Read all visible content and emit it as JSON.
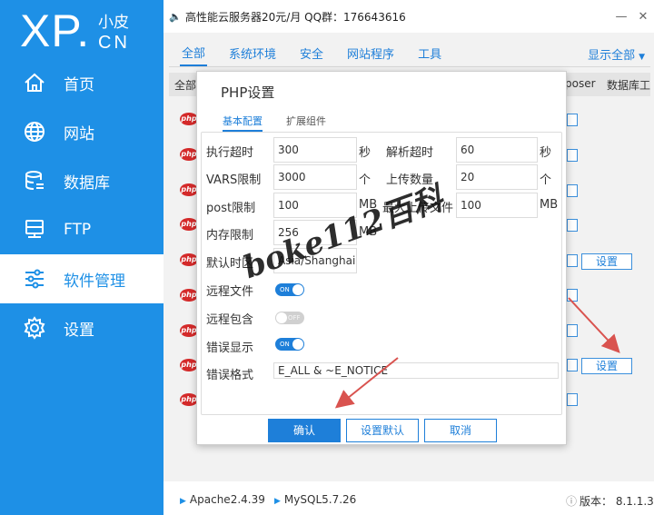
{
  "logo": {
    "big": "XP.",
    "small_top": "小皮",
    "small_bottom": "CN"
  },
  "sidebar": {
    "items": [
      {
        "label": "首页",
        "icon": "home-icon"
      },
      {
        "label": "网站",
        "icon": "globe-icon"
      },
      {
        "label": "数据库",
        "icon": "database-icon"
      },
      {
        "label": "FTP",
        "icon": "ftp-icon"
      },
      {
        "label": "软件管理",
        "icon": "sliders-icon",
        "active": true
      },
      {
        "label": "设置",
        "icon": "gear-icon"
      }
    ]
  },
  "topbar": {
    "notice": "高性能云服务器20元/月  QQ群：176643616",
    "min": "—",
    "close": "✕"
  },
  "tabs": {
    "items": [
      "全部",
      "系统环境",
      "安全",
      "网站程序",
      "工具"
    ],
    "right": "显示全部"
  },
  "table": {
    "header_left": "全部",
    "header_composer": "poser",
    "header_db": "数据库工"
  },
  "rows": {
    "php_label": "php",
    "set_label": "设置"
  },
  "dialog": {
    "title": "PHP设置",
    "tabs": [
      "基本配置",
      "扩展组件"
    ],
    "fields": {
      "exec_timeout": {
        "label": "执行超时",
        "value": "300",
        "unit": "秒"
      },
      "parse_timeout": {
        "label": "解析超时",
        "value": "60",
        "unit": "秒"
      },
      "vars_limit": {
        "label": "VARS限制",
        "value": "3000",
        "unit": "个"
      },
      "upload_count": {
        "label": "上传数量",
        "value": "20",
        "unit": "个"
      },
      "post_limit": {
        "label": "post限制",
        "value": "100",
        "unit": "MB"
      },
      "max_upload": {
        "label": "最大上传文件",
        "value": "100",
        "unit": "MB"
      },
      "memory_limit": {
        "label": "内存限制",
        "value": "256",
        "unit": "MB"
      },
      "timezone": {
        "label": "默认时区",
        "value": "Asia/Shanghai"
      },
      "remote_file": {
        "label": "远程文件",
        "state": "ON"
      },
      "remote_include": {
        "label": "远程包含",
        "state": "OFF"
      },
      "error_display": {
        "label": "错误显示",
        "state": "ON"
      },
      "error_format": {
        "label": "错误格式",
        "value": "E_ALL & ~E_NOTICE"
      }
    },
    "buttons": {
      "confirm": "确认",
      "default": "设置默认",
      "cancel": "取消"
    }
  },
  "status": {
    "apache": "Apache2.4.39",
    "mysql": "MySQL5.7.26",
    "version": "版本： 8.1.1.3"
  },
  "watermark": "boke112百科",
  "colors": {
    "sidebar": "#1e90e6",
    "accent": "#1e7fd9",
    "arrow": "#d9534f"
  }
}
